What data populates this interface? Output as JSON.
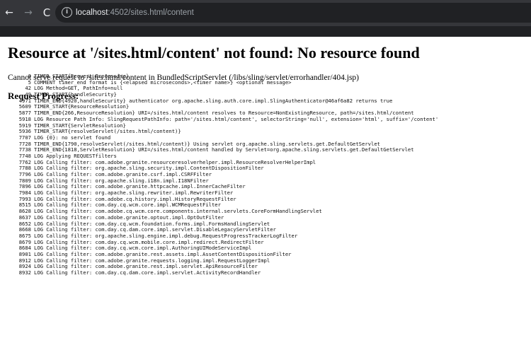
{
  "browser": {
    "back_icon": "←",
    "forward_icon": "→",
    "reload_icon": "C",
    "info_icon": "i",
    "url_host": "localhost",
    "url_path": ":4502/sites.html/content"
  },
  "page": {
    "title": "Resource at '/sites.html/content' not found: No resource found",
    "message": "Cannot serve request to /sites.html/content in BundledScriptServlet (/libs/sling/servlet/errorhandler/404.jsp)",
    "section_title": "Request Progress:"
  },
  "progress": [
    {
      "time": "0",
      "text": "TIMER_START{Request Processing}"
    },
    {
      "time": "5",
      "text": "COMMENT timer_end format is {<elapsed microseconds>,<timer name>} <optional message>"
    },
    {
      "time": "42",
      "text": "LOG Method=GET, PathInfo=null"
    },
    {
      "time": "49",
      "text": "TIMER_START{handleSecurity}"
    },
    {
      "time": "4971",
      "text": "TIMER_END{4920,handleSecurity} authenticator org.apache.sling.auth.core.impl.SlingAuthenticator@46af6a82 returns true"
    },
    {
      "time": "5609",
      "text": "TIMER_START{ResourceResolution}"
    },
    {
      "time": "5877",
      "text": "TIMER_END{266,ResourceResolution} URI=/sites.html/content resolves to Resource=NonExistingResource, path=/sites.html/content"
    },
    {
      "time": "5918",
      "text": "LOG Resource Path Info: SlingRequestPathInfo: path='/sites.html/content', selectorString='null', extension='html', suffix='/content'"
    },
    {
      "time": "5919",
      "text": "TIMER_START{ServletResolution}"
    },
    {
      "time": "5936",
      "text": "TIMER_START{resolveServlet(/sites.html/content)}"
    },
    {
      "time": "7707",
      "text": "LOG {0}: no servlet found"
    },
    {
      "time": "7728",
      "text": "TIMER_END{1790,resolveServlet(/sites.html/content)} Using servlet org.apache.sling.servlets.get.DefaultGetServlet"
    },
    {
      "time": "7738",
      "text": "TIMER_END{1818,ServletResolution} URI=/sites.html/content handled by Servlet=org.apache.sling.servlets.get.DefaultGetServlet"
    },
    {
      "time": "7748",
      "text": "LOG Applying REQUESTfilters"
    },
    {
      "time": "7762",
      "text": "LOG Calling filter: com.adobe.granite.resourceresolverhelper.impl.ResourceResolverHelperImpl"
    },
    {
      "time": "7788",
      "text": "LOG Calling filter: org.apache.sling.security.impl.ContentDispositionFilter"
    },
    {
      "time": "7796",
      "text": "LOG Calling filter: com.adobe.granite.csrf.impl.CSRFFilter"
    },
    {
      "time": "7809",
      "text": "LOG Calling filter: org.apache.sling.i18n.impl.I18NFilter"
    },
    {
      "time": "7896",
      "text": "LOG Calling filter: com.adobe.granite.httpcache.impl.InnerCacheFilter"
    },
    {
      "time": "7984",
      "text": "LOG Calling filter: org.apache.sling.rewriter.impl.RewriterFilter"
    },
    {
      "time": "7993",
      "text": "LOG Calling filter: com.adobe.cq.history.impl.HistoryRequestFilter"
    },
    {
      "time": "8515",
      "text": "LOG Calling filter: com.day.cq.wcm.core.impl.WCMRequestFilter"
    },
    {
      "time": "8628",
      "text": "LOG Calling filter: com.adobe.cq.wcm.core.components.internal.servlets.CoreFormHandlingServlet"
    },
    {
      "time": "8637",
      "text": "LOG Calling filter: com.adobe.granite.optout.impl.OptOutFilter"
    },
    {
      "time": "8652",
      "text": "LOG Calling filter: com.day.cq.wcm.foundation.forms.impl.FormsHandlingServlet"
    },
    {
      "time": "8668",
      "text": "LOG Calling filter: com.day.cq.dam.core.impl.servlet.DisableLegacyServletFilter"
    },
    {
      "time": "8675",
      "text": "LOG Calling filter: org.apache.sling.engine.impl.debug.RequestProgressTrackerLogFilter"
    },
    {
      "time": "8679",
      "text": "LOG Calling filter: com.day.cq.wcm.mobile.core.impl.redirect.RedirectFilter"
    },
    {
      "time": "8684",
      "text": "LOG Calling filter: com.day.cq.wcm.core.impl.AuthoringUIModeServiceImpl"
    },
    {
      "time": "8901",
      "text": "LOG Calling filter: com.adobe.granite.rest.assets.impl.AssetContentDispositionFilter"
    },
    {
      "time": "8912",
      "text": "LOG Calling filter: com.adobe.granite.requests.logging.impl.RequestLoggerImpl"
    },
    {
      "time": "8924",
      "text": "LOG Calling filter: com.adobe.granite.rest.impl.servlet.ApiResourceFilter"
    },
    {
      "time": "8932",
      "text": "LOG Calling filter: com.day.cq.dam.core.impl.servlet.ActivityRecordHandler"
    }
  ]
}
